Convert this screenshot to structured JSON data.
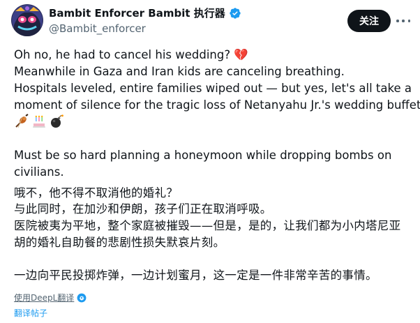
{
  "author": {
    "display_name": "Bambit Enforcer Bambit 执行器",
    "handle": "@Bambit_enforcer",
    "verified": true
  },
  "follow_label": "关注",
  "icons": {
    "verified": "verified-badge-icon",
    "more": "more-options-icon",
    "translate_settings": "gear-icon"
  },
  "post": {
    "en_line_1": "Oh no, he had to cancel his wedding? 💔",
    "en_line_2": "Meanwhile in Gaza and Iran kids are canceling breathing.",
    "en_line_3": "Hospitals leveled, entire families wiped out — but yes, let's all take a",
    "en_line_4": "moment of silence for the tragic loss of Netanyahu Jr.'s wedding buffet.",
    "emojis": [
      "violin",
      "birthday-cake",
      "bomb"
    ],
    "en_line_5": "Must be so hard planning a honeymoon while dropping bombs on",
    "en_line_6": "civilians.",
    "cn_line_1": "哦不，他不得不取消他的婚礼？",
    "cn_line_2": "与此同时，在加沙和伊朗，孩子们正在取消呼吸。",
    "cn_line_3": "医院被夷为平地，整个家庭被摧毁——但是，是的，让我们都为小内塔尼亚",
    "cn_line_4": "胡的婚礼自助餐的悲剧性损失默哀片刻。",
    "cn_line_5": "一边向平民投掷炸弹，一边计划蜜月，这一定是一件非常辛苦的事情。"
  },
  "translation": {
    "via_label": "使用DeepL翻译",
    "translate_post_label": "翻译帖子"
  },
  "colors": {
    "text": "#0f1419",
    "secondary": "#536471",
    "accent": "#1d9bf0",
    "button_bg": "#0f1419"
  }
}
